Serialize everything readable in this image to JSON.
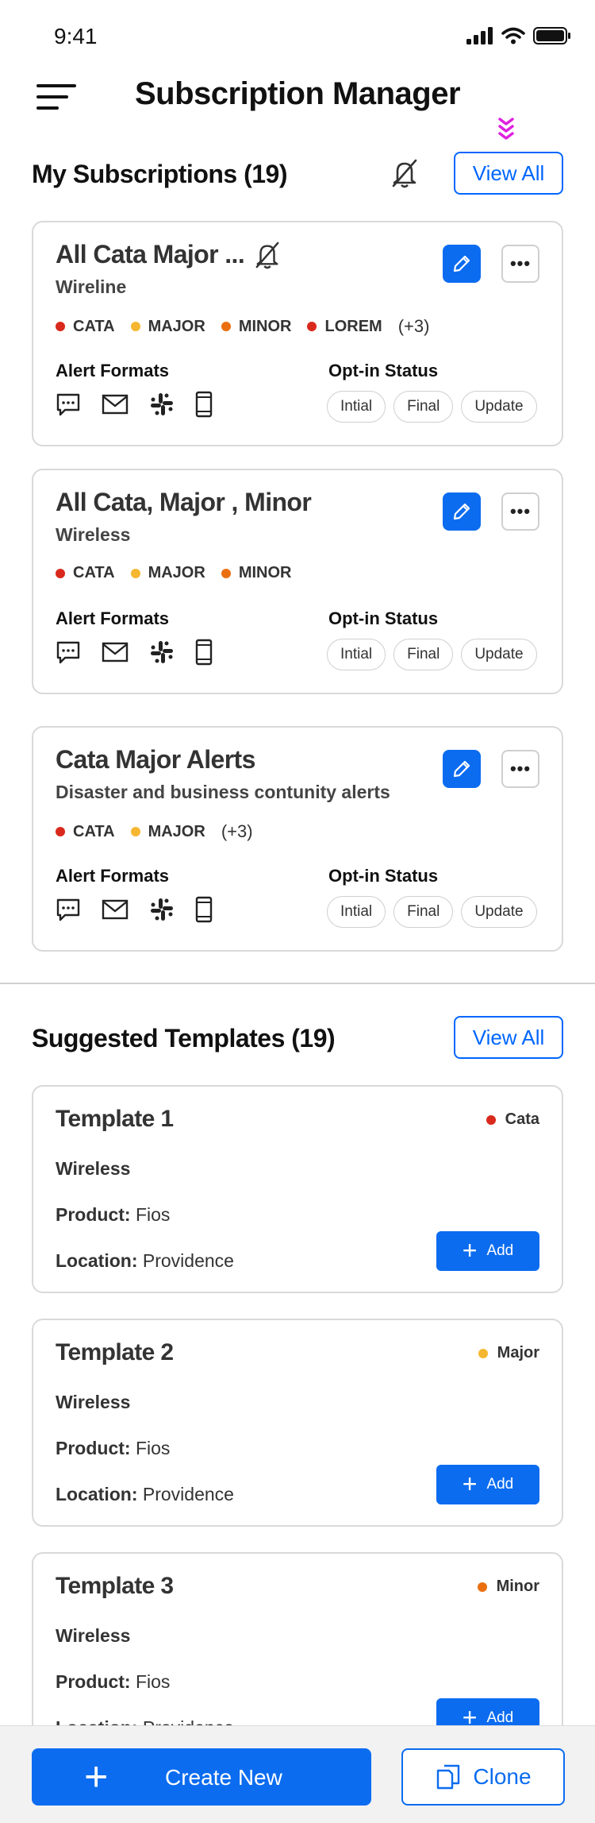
{
  "status_bar": {
    "time": "9:41"
  },
  "header": {
    "title": "Subscription Manager"
  },
  "subscriptions": {
    "title": "My Subscriptions (19)",
    "view_all_label": "View All",
    "cards": [
      {
        "title": "All Cata Major ...",
        "subtitle": "Wireline",
        "muted": true,
        "chips": [
          {
            "label": "CATA",
            "color": "#d9291c"
          },
          {
            "label": "MAJOR",
            "color": "#f5b731"
          },
          {
            "label": "MINOR",
            "color": "#ea6f10"
          },
          {
            "label": "LOREM",
            "color": "#d9291c"
          }
        ],
        "more": "(+3)",
        "alert_formats_label": "Alert Formats",
        "opt_in_label": "Opt-in Status",
        "pills": [
          "Intial",
          "Final",
          "Update"
        ]
      },
      {
        "title": "All Cata, Major , Minor",
        "subtitle": "Wireless",
        "muted": false,
        "chips": [
          {
            "label": "CATA",
            "color": "#d9291c"
          },
          {
            "label": "MAJOR",
            "color": "#f5b731"
          },
          {
            "label": "MINOR",
            "color": "#ea6f10"
          }
        ],
        "more": "",
        "alert_formats_label": "Alert Formats",
        "opt_in_label": "Opt-in Status",
        "pills": [
          "Intial",
          "Final",
          "Update"
        ]
      },
      {
        "title": "Cata Major Alerts",
        "subtitle": "Disaster and business contunity alerts",
        "muted": false,
        "chips": [
          {
            "label": "CATA",
            "color": "#d9291c"
          },
          {
            "label": "MAJOR",
            "color": "#f5b731"
          }
        ],
        "more": "(+3)",
        "alert_formats_label": "Alert Formats",
        "opt_in_label": "Opt-in Status",
        "pills": [
          "Intial",
          "Final",
          "Update"
        ]
      }
    ],
    "format_icons": [
      "message-icon",
      "mail-icon",
      "slack-icon",
      "mobile-icon"
    ]
  },
  "templates": {
    "title": "Suggested Templates (19)",
    "view_all_label": "View All",
    "product_label": "Product:",
    "location_label": "Location:",
    "add_label": "Add",
    "cards": [
      {
        "title": "Template 1",
        "severity": "Cata",
        "severity_color": "#d9291c",
        "network": "Wireless",
        "product": "Fios",
        "location": "Providence"
      },
      {
        "title": "Template 2",
        "severity": "Major",
        "severity_color": "#f5b731",
        "network": "Wireless",
        "product": "Fios",
        "location": "Providence"
      },
      {
        "title": "Template 3",
        "severity": "Minor",
        "severity_color": "#ea6f10",
        "network": "Wireless",
        "product": "Fios",
        "location": "Providence"
      }
    ]
  },
  "bottom_bar": {
    "create_label": "Create New",
    "clone_label": "Clone"
  },
  "colors": {
    "accent": "#0b6cf0",
    "chevron": "#e020e0"
  }
}
